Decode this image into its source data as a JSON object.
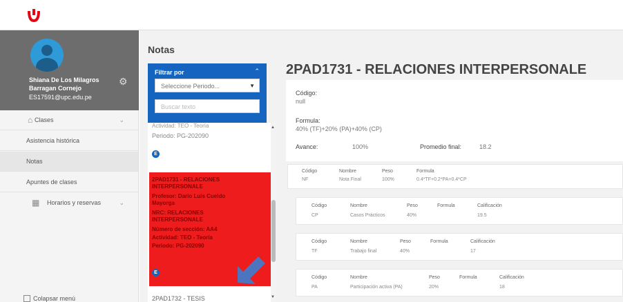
{
  "brand": {
    "logo_icon": "upc-logo-icon",
    "accent": "#e30613"
  },
  "profile": {
    "name_line1": "Shiana De Los Milagros",
    "name_line2": "Barragan Cornejo",
    "email": "ES17591@upc.edu.pe"
  },
  "sidebar": {
    "items": [
      {
        "label": "Clases",
        "icon": "building-icon"
      },
      {
        "label": "Asistencia histórica"
      },
      {
        "label": "Notas"
      },
      {
        "label": "Apuntes de clases"
      },
      {
        "label": "Horarios y reservas",
        "icon": "calendar-icon"
      }
    ],
    "collapse_label": "Colapsar menú"
  },
  "page": {
    "title": "Notas"
  },
  "filter": {
    "title": "Filtrar por",
    "select_placeholder": "Seleccione Periodo...",
    "search_placeholder": "Buscar texto"
  },
  "list": {
    "card1": {
      "cut_text": "Actividad: TEO - Teoría",
      "period": "Periodo: PG-202090",
      "badge": "E"
    },
    "card2": {
      "title1": "2PAD1731 - RELACIONES",
      "title2": "INTERPERSONALE",
      "prof1": "Profesor: Dario Luis Cueldo",
      "prof2": "Mayorga",
      "nrc1": "NRC: RELACIONES",
      "nrc2": "INTERPERSONALE",
      "section": "Número de sección: AA4",
      "activity": "Actividad: TEO - Teoría",
      "period": "Periodo: PG-202090",
      "badge": "E"
    },
    "card3": {
      "title": "2PAD1732 - TESIS"
    }
  },
  "detail": {
    "title": "2PAD1731 - RELACIONES INTERPERSONALE",
    "code_label": "Código:",
    "code_value": "null",
    "formula_label": "Formula:",
    "formula_value": "40% (TF)+20% (PA)+40% (CP)",
    "avance_label": "Avance:",
    "avance_value": "100%",
    "promedio_label": "Promedio final:",
    "promedio_value": "18.2"
  },
  "grades": {
    "headers": {
      "codigo": "Código",
      "nombre": "Nombre",
      "peso": "Peso",
      "formula": "Formula",
      "calificacion": "Calificación"
    },
    "final": {
      "codigo": "NF",
      "nombre": "Nota Final",
      "peso": "100%",
      "formula": "0.4*TF+0.2*PA+0.4*CP"
    },
    "rows": [
      {
        "codigo": "CP",
        "nombre": "Casos Prácticos",
        "peso": "40%",
        "formula": "",
        "calificacion": "19.5"
      },
      {
        "codigo": "TF",
        "nombre": "Trabajo final",
        "peso": "40%",
        "formula": "",
        "calificacion": "17"
      },
      {
        "codigo": "PA",
        "nombre": "Participación activa (PA)",
        "peso": "20%",
        "formula": "",
        "calificacion": "18"
      }
    ]
  }
}
